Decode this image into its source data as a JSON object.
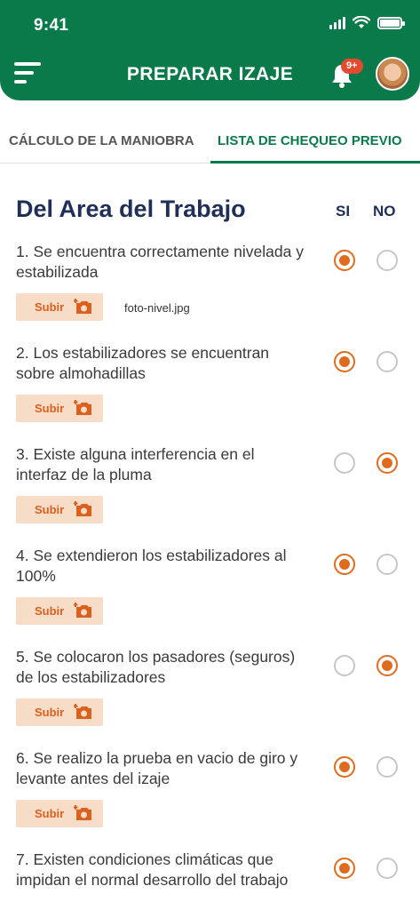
{
  "status_bar": {
    "time": "9:41"
  },
  "header": {
    "title": "PREPARAR IZAJE",
    "notification_badge": "9+"
  },
  "tabs": [
    {
      "label": "CÁLCULO DE LA MANIOBRA",
      "active": false
    },
    {
      "label": "LISTA DE CHEQUEO PREVIO",
      "active": true
    }
  ],
  "section": {
    "title": "Del Area del Trabajo",
    "col_si": "SI",
    "col_no": "NO"
  },
  "upload_label": "Subir",
  "colors": {
    "primary_green": "#0b7a4b",
    "accent_orange": "#de6c1f",
    "upload_bg": "#f7dcc8",
    "title_navy": "#1f2f57"
  },
  "items": [
    {
      "text": "1. Se  encuentra correctamente nivelada y estabilizada",
      "answer": "si",
      "file": "foto-nivel.jpg"
    },
    {
      "text": "2. Los estabilizadores se encuentran sobre almohadillas",
      "answer": "si"
    },
    {
      "text": "3. Existe alguna interferencia en el interfaz de la pluma",
      "answer": "no"
    },
    {
      "text": "4. Se extendieron los estabilizadores al 100%",
      "answer": "si"
    },
    {
      "text": "5. Se colocaron los pasadores (seguros) de los estabilizadores",
      "answer": "no"
    },
    {
      "text": "6. Se realizo la prueba en vacio de giro y levante antes del izaje",
      "answer": "si"
    },
    {
      "text": "7. Existen condiciones climáticas que impidan el normal desarrollo del trabajo",
      "answer": "si"
    }
  ]
}
